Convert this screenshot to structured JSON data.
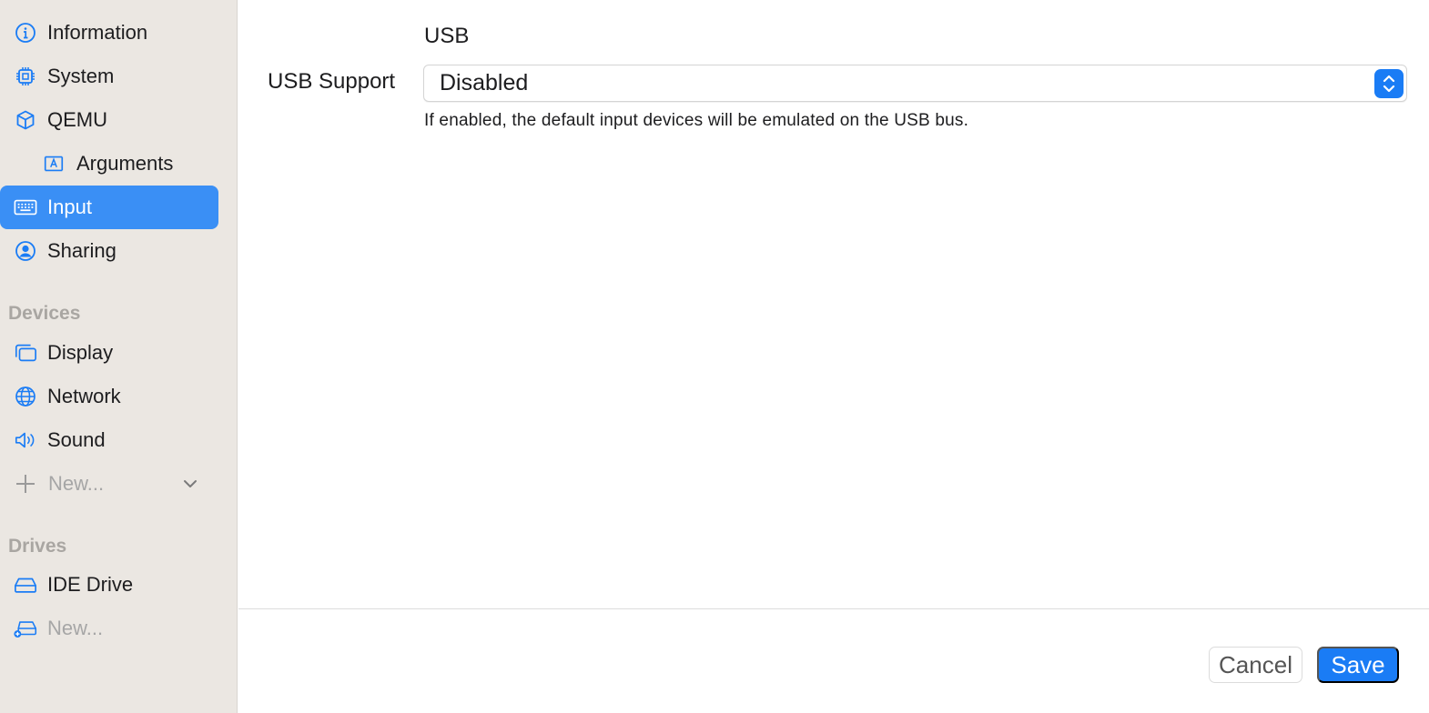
{
  "sidebar": {
    "items": [
      {
        "label": "Information",
        "icon": "info-circle-icon"
      },
      {
        "label": "System",
        "icon": "cpu-chip-icon"
      },
      {
        "label": "QEMU",
        "icon": "cube-icon"
      },
      {
        "label": "Arguments",
        "icon": "text-box-a-icon"
      },
      {
        "label": "Input",
        "icon": "keyboard-icon"
      },
      {
        "label": "Sharing",
        "icon": "person-circle-icon"
      }
    ],
    "devices_header": "Devices",
    "devices": [
      {
        "label": "Display",
        "icon": "display-windows-icon"
      },
      {
        "label": "Network",
        "icon": "globe-icon"
      },
      {
        "label": "Sound",
        "icon": "speaker-icon"
      }
    ],
    "new_device_label": "New...",
    "drives_header": "Drives",
    "drives": [
      {
        "label": "IDE Drive",
        "icon": "drive-icon"
      }
    ],
    "new_drive_label": "New..."
  },
  "main": {
    "section_title": "USB",
    "usb_support_label": "USB Support",
    "usb_support_value": "Disabled",
    "help_text": "If enabled, the default input devices will be emulated on the USB bus."
  },
  "footer": {
    "cancel_label": "Cancel",
    "save_label": "Save"
  },
  "colors": {
    "accent": "#1a7cf5",
    "selection": "#3a8ff5",
    "sidebar_bg": "#ebe7e2"
  }
}
